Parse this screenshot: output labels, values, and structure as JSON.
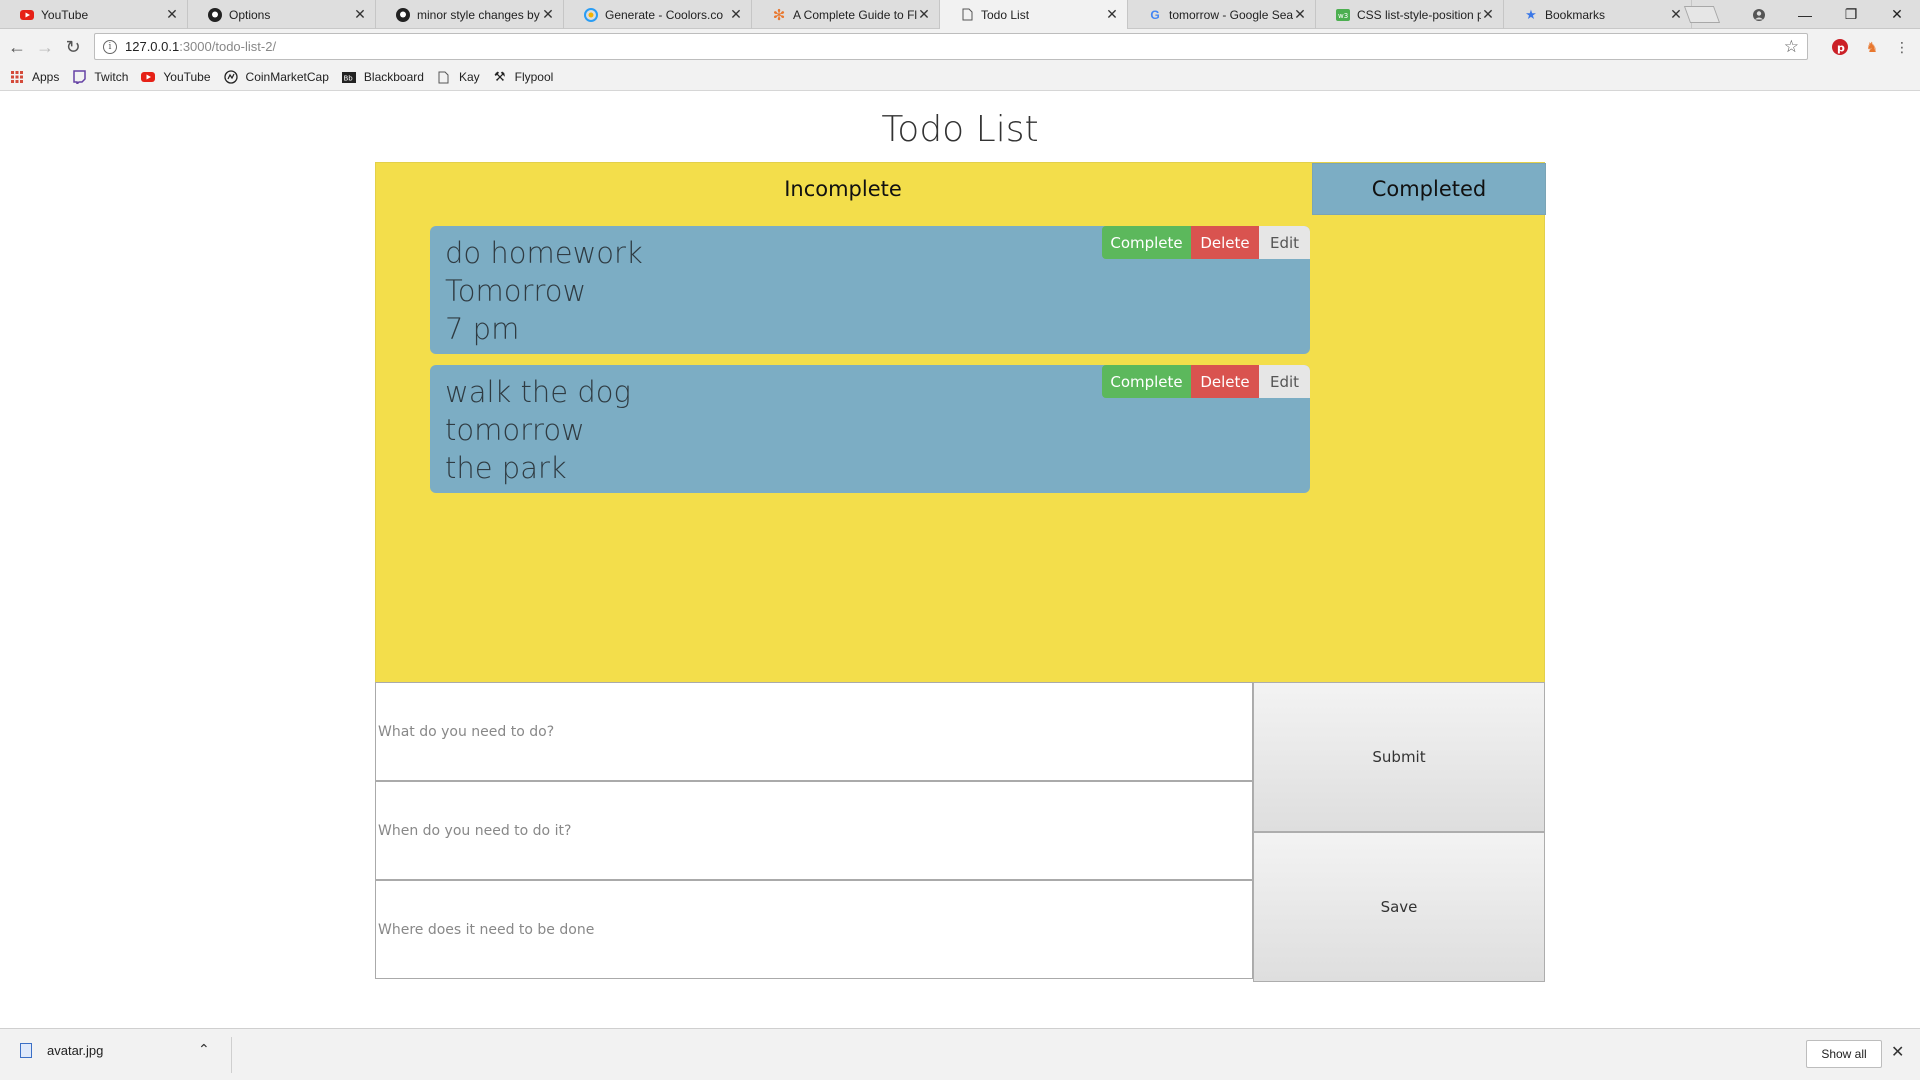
{
  "browser": {
    "tabs": [
      {
        "title": "YouTube",
        "icon": "youtube-icon",
        "active": false
      },
      {
        "title": "Options",
        "icon": "github-icon",
        "active": false
      },
      {
        "title": "minor style changes by",
        "icon": "github-icon",
        "active": false
      },
      {
        "title": "Generate - Coolors.co",
        "icon": "coolors-icon",
        "active": false
      },
      {
        "title": "A Complete Guide to Fl",
        "icon": "css-tricks-icon",
        "active": false
      },
      {
        "title": "Todo List",
        "icon": "page-icon",
        "active": true
      },
      {
        "title": "tomorrow - Google Sea",
        "icon": "google-icon",
        "active": false
      },
      {
        "title": "CSS list-style-position p",
        "icon": "w3schools-icon",
        "active": false
      },
      {
        "title": "Bookmarks",
        "icon": "star-icon",
        "active": false
      }
    ],
    "url_host": "127.0.0.1",
    "url_path": ":3000/todo-list-2/",
    "bookmarks": [
      {
        "label": "Apps",
        "icon": "apps-grid-icon"
      },
      {
        "label": "Twitch",
        "icon": "twitch-icon"
      },
      {
        "label": "YouTube",
        "icon": "youtube-icon"
      },
      {
        "label": "CoinMarketCap",
        "icon": "coinmarketcap-icon"
      },
      {
        "label": "Blackboard",
        "icon": "blackboard-icon"
      },
      {
        "label": "Kay",
        "icon": "page-icon"
      },
      {
        "label": "Flypool",
        "icon": "pickaxe-icon"
      }
    ]
  },
  "app": {
    "title": "Todo List",
    "tabs": {
      "incomplete": "Incomplete",
      "completed": "Completed"
    },
    "todos": [
      {
        "what": "do homework",
        "when": "Tomorrow",
        "where": "7 pm"
      },
      {
        "what": "walk the dog",
        "when": "tomorrow",
        "where": "the park"
      }
    ],
    "actions": {
      "complete": "Complete",
      "delete": "Delete",
      "edit": "Edit"
    },
    "form": {
      "what_placeholder": "What do you need to do?",
      "when_placeholder": "When do you need to do it?",
      "where_placeholder": "Where does it need to be done",
      "submit_label": "Submit",
      "save_label": "Save"
    },
    "colors": {
      "board": "#f3de4b",
      "card": "#7cadc4",
      "complete": "#5cb85c",
      "delete": "#d9534f"
    }
  },
  "downloads": {
    "file_name": "avatar.jpg",
    "show_all": "Show all"
  }
}
